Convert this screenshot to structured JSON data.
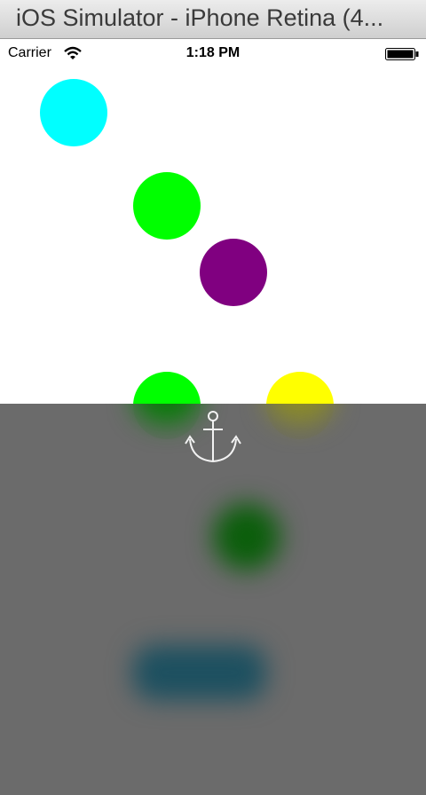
{
  "window": {
    "title": "iOS Simulator - iPhone Retina (4..."
  },
  "statusbar": {
    "carrier": "Carrier",
    "time": "1:18 PM",
    "wifi_icon": "wifi-icon",
    "battery_icon": "battery-icon"
  },
  "circles": [
    {
      "name": "cyan-circle",
      "color": "#00ffff"
    },
    {
      "name": "green-circle-top",
      "color": "#00ff00"
    },
    {
      "name": "purple-circle",
      "color": "#800080"
    },
    {
      "name": "green-circle-bottom",
      "color": "#00ff00"
    },
    {
      "name": "yellow-circle",
      "color": "#ffff00"
    }
  ],
  "overlay": {
    "anchor_icon": "anchor-icon",
    "color": "#666666"
  }
}
